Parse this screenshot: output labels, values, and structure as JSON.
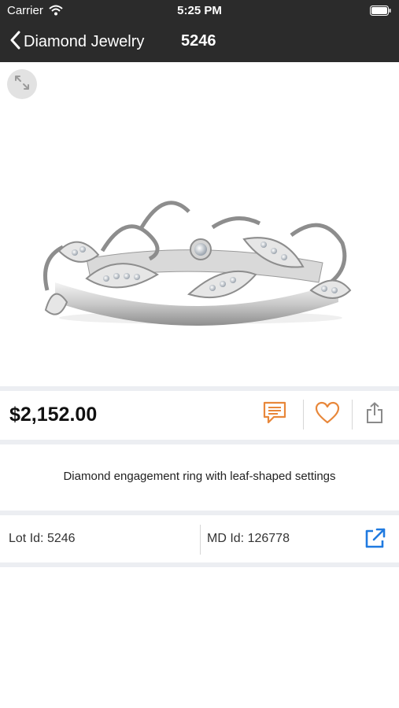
{
  "status_bar": {
    "carrier": "Carrier",
    "time": "5:25 PM"
  },
  "nav": {
    "back_label": "Diamond Jewelry",
    "title": "5246"
  },
  "product": {
    "price": "$2,152.00",
    "description": "Diamond engagement ring with leaf-shaped settings",
    "lot_id_label": "Lot Id:",
    "lot_id_value": "5246",
    "md_id_label": "MD Id:",
    "md_id_value": "126778"
  },
  "icons": {
    "expand": "expand-icon",
    "message": "message-icon",
    "favorite": "heart-icon",
    "share": "share-icon",
    "external_link": "external-link-icon"
  },
  "colors": {
    "nav_background": "#2b2b2b",
    "accent_orange": "#e8873a",
    "link_blue": "#1f7ae0",
    "divider": "#eceef2"
  }
}
